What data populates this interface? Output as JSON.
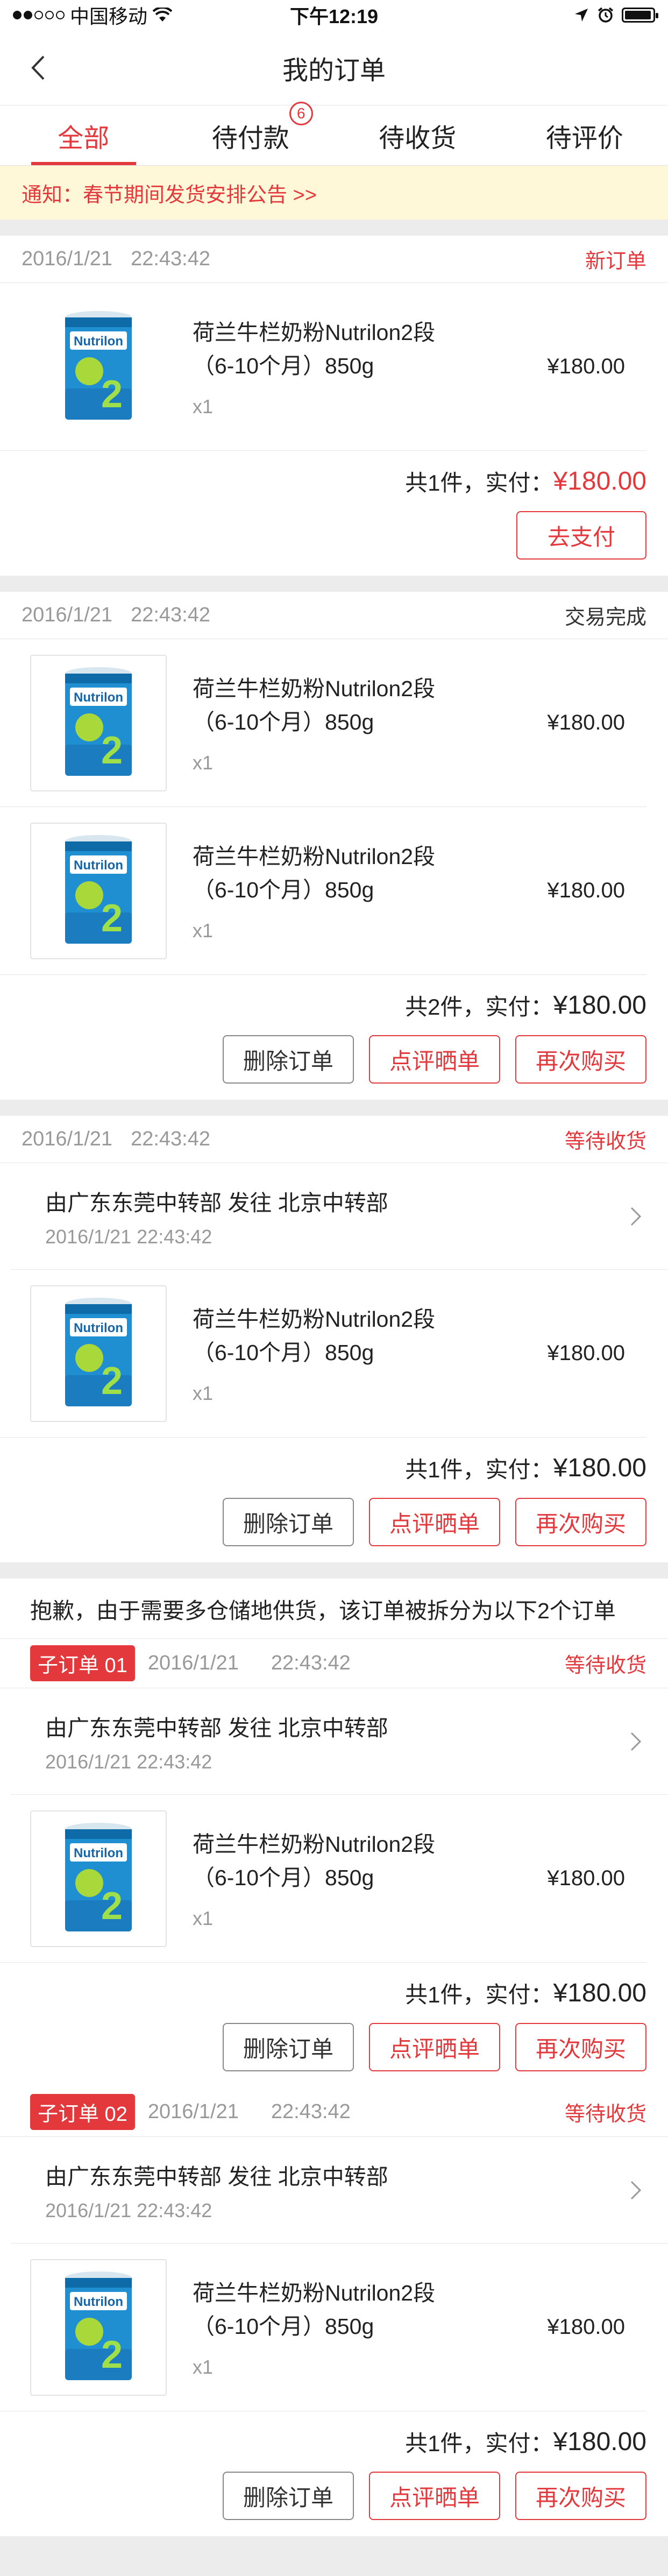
{
  "status_bar": {
    "carrier": "中国移动",
    "time": "下午12:19"
  },
  "header": {
    "title": "我的订单"
  },
  "tabs": [
    {
      "label": "全部"
    },
    {
      "label": "待付款",
      "badge": "6"
    },
    {
      "label": "待收货"
    },
    {
      "label": "待评价"
    }
  ],
  "notice": "通知：春节期间发货安排公告 >>",
  "product": {
    "name_line1": "荷兰牛栏奶粉Nutrilon2段",
    "name_line2": "（6-10个月）850g",
    "qty": "x1",
    "price": "¥180.00",
    "brand": "Nutrilon"
  },
  "orders": [
    {
      "date": "2016/1/21",
      "time": "22:43:42",
      "status": "新订单",
      "summary_prefix": "共1件，实付：",
      "total": "¥180.00",
      "action": "去支付"
    },
    {
      "date": "2016/1/21",
      "time": "22:43:42",
      "status": "交易完成",
      "summary_prefix": "共2件，实付：",
      "total": "¥180.00"
    },
    {
      "date": "2016/1/21",
      "time": "22:43:42",
      "status": "等待收货",
      "logistics_route": "由广东东莞中转部 发往 北京中转部",
      "logistics_time": "2016/1/21    22:43:42",
      "summary_prefix": "共1件，实付：",
      "total": "¥180.00"
    }
  ],
  "buttons": {
    "delete": "删除订单",
    "review": "点评晒单",
    "rebuy": "再次购买"
  },
  "split": {
    "note": "抱歉，由于需要多仓储地供货，该订单被拆分为以下2个订单",
    "sub_orders": [
      {
        "tag": "子订单 01",
        "date": "2016/1/21",
        "time": "22:43:42",
        "status": "等待收货",
        "logistics_route": "由广东东莞中转部 发往 北京中转部",
        "logistics_time": "2016/1/21    22:43:42",
        "summary_prefix": "共1件，实付：",
        "total": "¥180.00"
      },
      {
        "tag": "子订单 02",
        "date": "2016/1/21",
        "time": "22:43:42",
        "status": "等待收货",
        "logistics_route": "由广东东莞中转部 发往 北京中转部",
        "logistics_time": "2016/1/21    22:43:42",
        "summary_prefix": "共1件，实付：",
        "total": "¥180.00"
      }
    ]
  },
  "colors": {
    "accent": "#e4393c",
    "notice_bg": "#fff8d8",
    "page_bg": "#ececec"
  },
  "icons": {
    "back": "chevron-left-icon",
    "logistics": "chevron-right-icon",
    "wifi": "wifi-icon",
    "location": "location-arrow-icon",
    "alarm": "alarm-icon",
    "battery": "battery-icon",
    "signal": "signal-icon"
  },
  "battery_level": 0.95
}
